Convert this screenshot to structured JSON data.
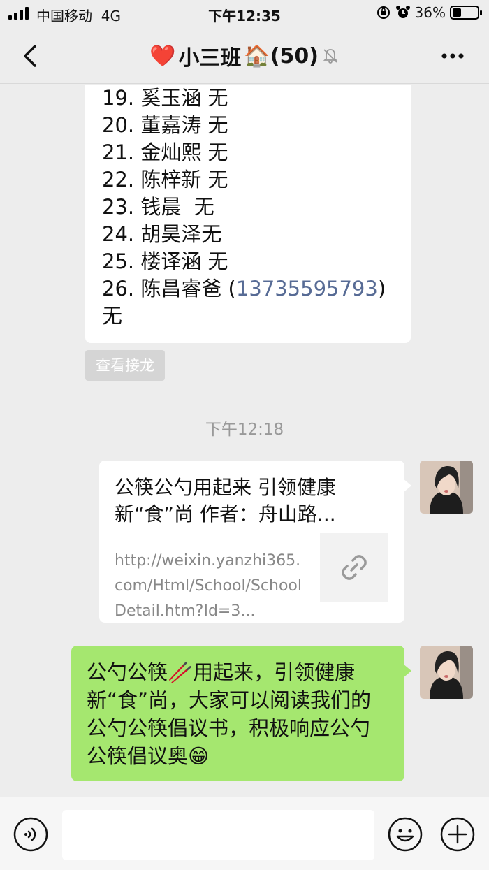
{
  "status_bar": {
    "carrier": "中国移动",
    "network": "4G",
    "time": "下午12:35",
    "battery": "36%",
    "battery_level": 0.36
  },
  "header": {
    "title_prefix": "❤️",
    "title": "小三班",
    "title_suffix": "🏠(50)",
    "icons": [
      "back-arrow-icon",
      "mute-bell-icon",
      "more-icon"
    ]
  },
  "jielong": {
    "lines": [
      "19. 奚玉涵 无",
      "20. 董嘉涛 无",
      "21. 金灿熙 无",
      "22. 陈梓新 无",
      "23. 钱晨  无",
      "24. 胡昊泽无",
      "25. 楼译涵 无"
    ],
    "line26_prefix": "26. 陈昌睿爸 (",
    "line26_phone": "13735595793",
    "line26_suffix": ")",
    "line27": "无",
    "view_button": "查看接龙"
  },
  "timestamp": "下午12:18",
  "link_card": {
    "title": "公筷公勺用起来 引领健康新“食”尚 作者：舟山路...",
    "url": "http://weixin.yanzhi365.com/Html/School/SchoolDetail.htm?Id=3...",
    "thumb_icon": "link-icon"
  },
  "green_message": {
    "text": "公勺公筷🥢用起来，引领健康新“食”尚，大家可以阅读我们的公勺公筷倡议书，积极响应公勺公筷倡议奥😁"
  },
  "input_bar": {
    "icons": [
      "voice-icon",
      "emoji-icon",
      "plus-icon"
    ],
    "value": ""
  },
  "colors": {
    "background": "#ededed",
    "green_bubble": "#a5e76f",
    "link_blue": "#576b95"
  }
}
